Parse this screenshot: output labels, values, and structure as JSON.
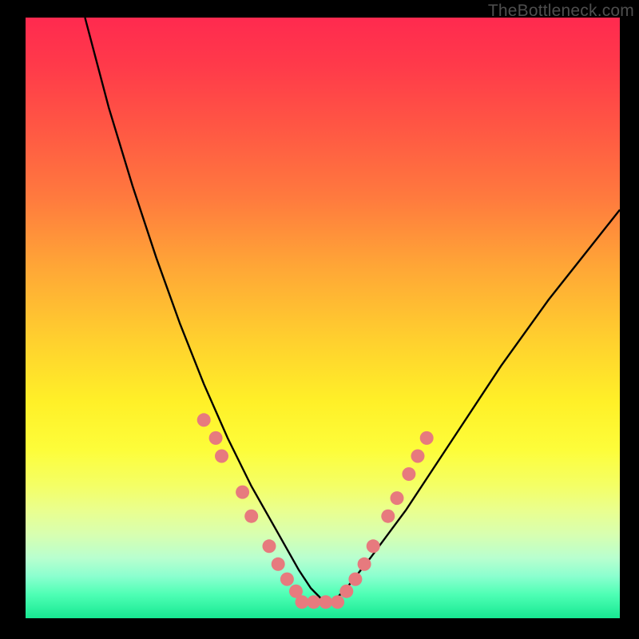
{
  "watermark": "TheBottleneck.com",
  "chart_data": {
    "type": "line",
    "title": "",
    "xlabel": "",
    "ylabel": "",
    "xlim": [
      0,
      100
    ],
    "ylim": [
      0,
      100
    ],
    "series": [
      {
        "name": "curve",
        "x": [
          10,
          14,
          18,
          22,
          26,
          30,
          34,
          38,
          42,
          46,
          48,
          50,
          52,
          54,
          58,
          64,
          72,
          80,
          88,
          96,
          100
        ],
        "y": [
          100,
          85,
          72,
          60,
          49,
          39,
          30,
          22,
          15,
          8,
          5,
          3,
          3,
          5,
          10,
          18,
          30,
          42,
          53,
          63,
          68
        ]
      }
    ],
    "markers": {
      "color": "#e77a7e",
      "points_left": [
        [
          30,
          33
        ],
        [
          32,
          30
        ],
        [
          33,
          27
        ],
        [
          36.5,
          21
        ],
        [
          38,
          17
        ],
        [
          41,
          12
        ],
        [
          42.5,
          9
        ],
        [
          44,
          6.5
        ],
        [
          45.5,
          4.5
        ]
      ],
      "points_right": [
        [
          54,
          4.5
        ],
        [
          55.5,
          6.5
        ],
        [
          57,
          9
        ],
        [
          58.5,
          12
        ],
        [
          61,
          17
        ],
        [
          62.5,
          20
        ],
        [
          64.5,
          24
        ],
        [
          66,
          27
        ],
        [
          67.5,
          30
        ]
      ],
      "flat_bottom": [
        [
          46.5,
          2.7
        ],
        [
          48.5,
          2.7
        ],
        [
          50.5,
          2.7
        ],
        [
          52.5,
          2.7
        ]
      ]
    }
  }
}
